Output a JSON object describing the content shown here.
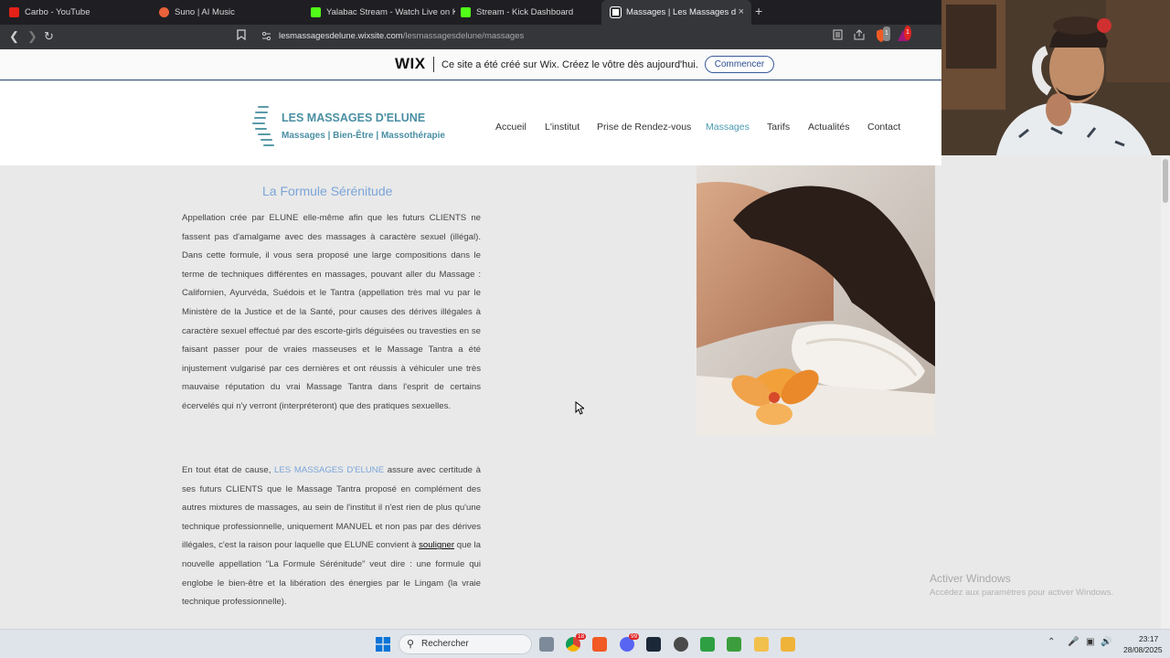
{
  "browser": {
    "tabs": [
      {
        "label": "Carbo - YouTube",
        "color": "#e62117"
      },
      {
        "label": "Suno | AI Music",
        "color": "#e8623a"
      },
      {
        "label": "Yalabac Stream - Watch Live on Kick",
        "color": "#53fc18"
      },
      {
        "label": "Stream - Kick Dashboard",
        "color": "#53fc18"
      },
      {
        "label": "Massages | Les Massages d'Elun",
        "color": "#ffffff"
      }
    ],
    "new_tab": "+",
    "close_tab": "×",
    "url_host": "lesmassagesdelune.wixsite.com",
    "url_path": "/lesmassagesdelune/massages",
    "shield_badge": "1",
    "ext_badge": "1"
  },
  "wix_banner": {
    "logo": "WIX",
    "message": "Ce site a été créé sur Wix. Créez le vôtre dès aujourd'hui.",
    "button": "Commencer"
  },
  "site": {
    "brand_title": "LES MASSAGES D'ELUNE",
    "brand_subtitle": "Massages | Bien-Être | Massothérapie",
    "brand_color": "#4a8fa3",
    "nav": [
      {
        "label": "Accueil",
        "active": false
      },
      {
        "label": "L'institut",
        "active": false
      },
      {
        "label": "Prise de Rendez-vous",
        "active": false
      },
      {
        "label": "Massages",
        "active": true
      },
      {
        "label": "Tarifs",
        "active": false
      },
      {
        "label": "Actualités",
        "active": false
      },
      {
        "label": "Contact",
        "active": false
      }
    ]
  },
  "content": {
    "section_title": "La Formule Sérénitude",
    "paragraph1": "Appellation crée par ELUNE elle-même afin que les futurs CLIENTS ne fassent pas d'amalgame avec des massages à caractère sexuel (illégal). Dans cette formule, il vous sera proposé une large compositions dans le terme de techniques différentes en massages, pouvant aller du Massage : Californien, Ayurvéda, Suédois et le Tantra (appellation très mal vu par le Ministère de la Justice et de la Santé, pour causes des dérives illégales à caractère sexuel effectué par des escorte-girls déguisées ou travesties en se faisant passer pour de vraies masseuses et le Massage Tantra a été injustement vulgarisé par ces dernières et ont réussis à véhiculer une très mauvaise réputation du vrai Massage Tantra dans l'esprit de certains écervelés qui n'y verront (interpréteront) que des pratiques sexuelles.",
    "p2_a": "En tout état de cause, ",
    "p2_link": "LES MASSAGES D'ELUNE",
    "p2_b": " assure avec certitude à ses futurs CLIENTS que le Massage Tantra proposé en complément des autres mixtures de massages, au sein de l'institut il n'est rien de plus qu'une technique professionnelle, uniquement MANUEL et non pas par des dérives illégales, c'est la raison pour laquelle que ELUNE convient à ",
    "p2_underline": "souligner",
    "p2_c": " que la nouvelle appellation \"La Formule Sérénitude\" veut dire : une formule qui englobe le  bien-être et la libération des énergies par le Lingam (la vraie technique professionnelle).",
    "accent_color": "#7aa5d8"
  },
  "os": {
    "activate_title": "Activer Windows",
    "activate_sub": "Accédez aux paramètres pour activer Windows.",
    "search_label": "Rechercher",
    "time": "23:17",
    "date": "28/08/2025",
    "chrome_badge": "18",
    "discord_badge": "99"
  }
}
